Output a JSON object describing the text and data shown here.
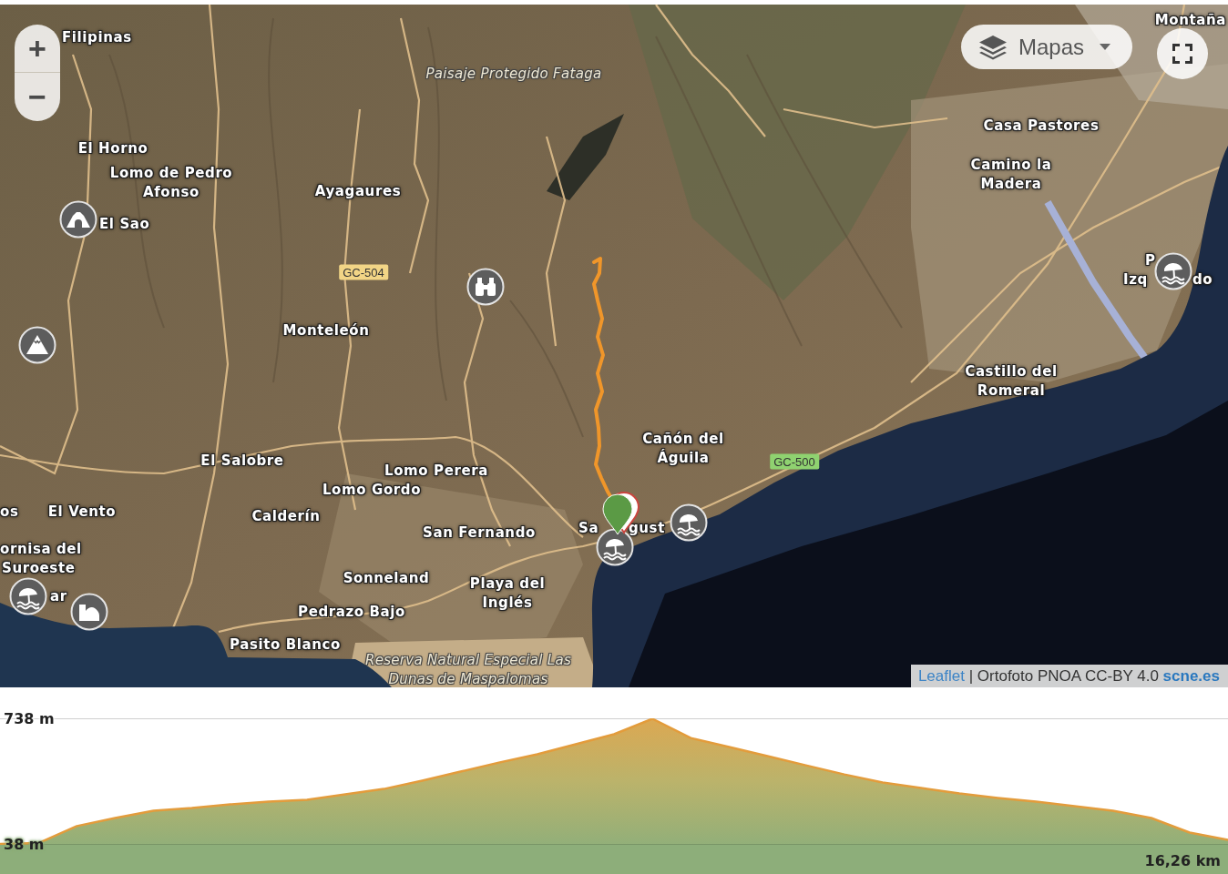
{
  "map": {
    "zoom_controls": [
      {
        "label": "+"
      },
      {
        "label": "−"
      }
    ],
    "layer_switcher": {
      "label": "Mapas"
    },
    "place_labels": [
      {
        "text": "Montaña",
        "kind": "place"
      },
      {
        "text": "Filipinas",
        "kind": "place"
      },
      {
        "text": "Paisaje Protegido Fataga",
        "kind": "area"
      },
      {
        "text": "Casa Pastores",
        "kind": "place"
      },
      {
        "text": "El Horno",
        "kind": "place"
      },
      {
        "text": "Lomo de Pedro Afonso",
        "kind": "place"
      },
      {
        "text": "Ayagaures",
        "kind": "place"
      },
      {
        "text": "Camino la Madera",
        "kind": "place"
      },
      {
        "text": "El Sao",
        "kind": "place"
      },
      {
        "text": "P",
        "kind": "place"
      },
      {
        "text": "Izq",
        "kind": "place"
      },
      {
        "text": "do",
        "kind": "place"
      },
      {
        "text": "Monteleón",
        "kind": "place"
      },
      {
        "text": "Castillo del Romeral",
        "kind": "place"
      },
      {
        "text": "El Salobre",
        "kind": "place"
      },
      {
        "text": "Lomo Perera",
        "kind": "place"
      },
      {
        "text": "Cañón del Águila",
        "kind": "place"
      },
      {
        "text": "Lomo Gordo",
        "kind": "place"
      },
      {
        "text": "os",
        "kind": "place"
      },
      {
        "text": "El Vento",
        "kind": "place"
      },
      {
        "text": "Calderín",
        "kind": "place"
      },
      {
        "text": "San Fernando",
        "kind": "place"
      },
      {
        "text": "Sa",
        "kind": "place"
      },
      {
        "text": "gust",
        "kind": "place"
      },
      {
        "text": "ornisa del",
        "kind": "place"
      },
      {
        "text": "Suroeste",
        "kind": "place"
      },
      {
        "text": "Sonneland",
        "kind": "place"
      },
      {
        "text": "ar",
        "kind": "place"
      },
      {
        "text": "Pedrazo Bajo",
        "kind": "place"
      },
      {
        "text": "Playa del Inglés",
        "kind": "place"
      },
      {
        "text": "Pasito Blanco",
        "kind": "place"
      },
      {
        "text": "Reserva Natural Especial Las Dunas de Maspalomas",
        "kind": "area"
      }
    ],
    "road_shields": [
      {
        "text": "GC-504",
        "color": "#f2d586"
      },
      {
        "text": "GC-500",
        "color": "#8fd270"
      }
    ],
    "poi_markers": [
      {
        "kind": "cave"
      },
      {
        "kind": "beach"
      },
      {
        "kind": "binoculars"
      },
      {
        "kind": "peak"
      },
      {
        "kind": "beach"
      },
      {
        "kind": "beach"
      },
      {
        "kind": "beach"
      },
      {
        "kind": "building"
      }
    ],
    "attribution": [
      {
        "text": "Leaflet",
        "kind": "link"
      },
      {
        "text": "| Ortofoto PNOA CC-BY 4.0",
        "kind": "text"
      },
      {
        "text": "scne.es",
        "kind": "bold_link"
      }
    ]
  },
  "elevation_profile": {
    "chart_data": {
      "type": "area",
      "series": [
        {
          "color": "#e39c3c",
          "values": [
            40,
            45,
            140,
            185,
            226,
            241,
            261,
            276,
            286,
            317,
            347,
            393,
            444,
            494,
            540,
            596,
            652,
            738,
            631,
            581,
            530,
            479,
            428,
            383,
            352,
            322,
            297,
            276,
            251,
            226,
            185,
            104,
            63
          ]
        }
      ],
      "ylim": [
        38,
        738
      ],
      "yticks": [
        {
          "value": 38,
          "label": "38 m"
        },
        {
          "value": 738,
          "label": "738 m"
        }
      ],
      "annotations": [
        "16,26 km"
      ]
    }
  }
}
